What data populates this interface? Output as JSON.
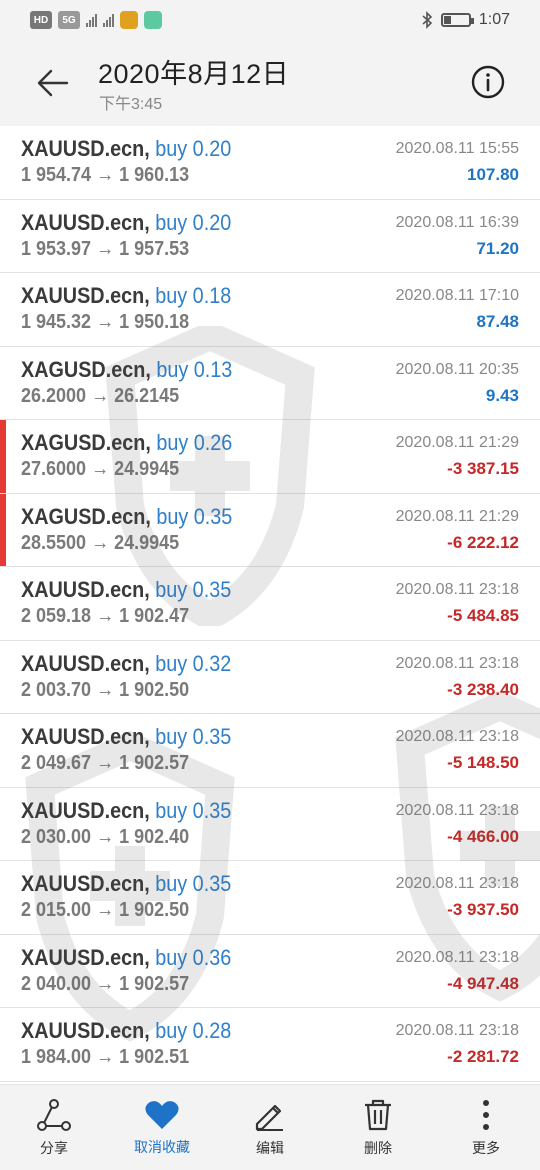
{
  "status_bar": {
    "hd_label": "HD",
    "network_label": "5G",
    "time": "1:07",
    "battery_level": 0.3
  },
  "header": {
    "title": "2020年8月12日",
    "subtitle": "下午3:45"
  },
  "trades": [
    {
      "symbol": "XAUUSD.ecn,",
      "side": "buy 0.20",
      "prices": "1 954.74 → 1 960.13",
      "time": "2020.08.11 15:55",
      "profit": "107.80",
      "negative": false,
      "marked": false
    },
    {
      "symbol": "XAUUSD.ecn,",
      "side": "buy 0.20",
      "prices": "1 953.97 → 1 957.53",
      "time": "2020.08.11 16:39",
      "profit": "71.20",
      "negative": false,
      "marked": false
    },
    {
      "symbol": "XAUUSD.ecn,",
      "side": "buy 0.18",
      "prices": "1 945.32 → 1 950.18",
      "time": "2020.08.11 17:10",
      "profit": "87.48",
      "negative": false,
      "marked": false
    },
    {
      "symbol": "XAGUSD.ecn,",
      "side": "buy 0.13",
      "prices": "26.2000 → 26.2145",
      "time": "2020.08.11 20:35",
      "profit": "9.43",
      "negative": false,
      "marked": false
    },
    {
      "symbol": "XAGUSD.ecn,",
      "side": "buy 0.26",
      "prices": "27.6000 → 24.9945",
      "time": "2020.08.11 21:29",
      "profit": "-3 387.15",
      "negative": true,
      "marked": true
    },
    {
      "symbol": "XAGUSD.ecn,",
      "side": "buy 0.35",
      "prices": "28.5500 → 24.9945",
      "time": "2020.08.11 21:29",
      "profit": "-6 222.12",
      "negative": true,
      "marked": true
    },
    {
      "symbol": "XAUUSD.ecn,",
      "side": "buy 0.35",
      "prices": "2 059.18 → 1 902.47",
      "time": "2020.08.11 23:18",
      "profit": "-5 484.85",
      "negative": true,
      "marked": false
    },
    {
      "symbol": "XAUUSD.ecn,",
      "side": "buy 0.32",
      "prices": "2 003.70 → 1 902.50",
      "time": "2020.08.11 23:18",
      "profit": "-3 238.40",
      "negative": true,
      "marked": false
    },
    {
      "symbol": "XAUUSD.ecn,",
      "side": "buy 0.35",
      "prices": "2 049.67 → 1 902.57",
      "time": "2020.08.11 23:18",
      "profit": "-5 148.50",
      "negative": true,
      "marked": false
    },
    {
      "symbol": "XAUUSD.ecn,",
      "side": "buy 0.35",
      "prices": "2 030.00 → 1 902.40",
      "time": "2020.08.11 23:18",
      "profit": "-4 466.00",
      "negative": true,
      "marked": false
    },
    {
      "symbol": "XAUUSD.ecn,",
      "side": "buy 0.35",
      "prices": "2 015.00 → 1 902.50",
      "time": "2020.08.11 23:18",
      "profit": "-3 937.50",
      "negative": true,
      "marked": false
    },
    {
      "symbol": "XAUUSD.ecn,",
      "side": "buy 0.36",
      "prices": "2 040.00 → 1 902.57",
      "time": "2020.08.11 23:18",
      "profit": "-4 947.48",
      "negative": true,
      "marked": false
    },
    {
      "symbol": "XAUUSD.ecn,",
      "side": "buy 0.28",
      "prices": "1 984.00 → 1 902.51",
      "time": "2020.08.11 23:18",
      "profit": "-2 281.72",
      "negative": true,
      "marked": false
    }
  ],
  "bottom_bar": {
    "share": "分享",
    "unfavorite": "取消收藏",
    "edit": "编辑",
    "delete": "删除",
    "more": "更多"
  },
  "colors": {
    "positive": "#1f74c4",
    "negative": "#c62828",
    "side": "#2f7fca",
    "marker": "#e53935",
    "accent": "#1e73c8"
  },
  "icons": {
    "back": "arrow-left-icon",
    "info": "info-icon",
    "share": "share-icon",
    "unfavorite": "heart-icon",
    "edit": "pencil-icon",
    "delete": "trash-icon",
    "more": "more-vertical-icon"
  }
}
